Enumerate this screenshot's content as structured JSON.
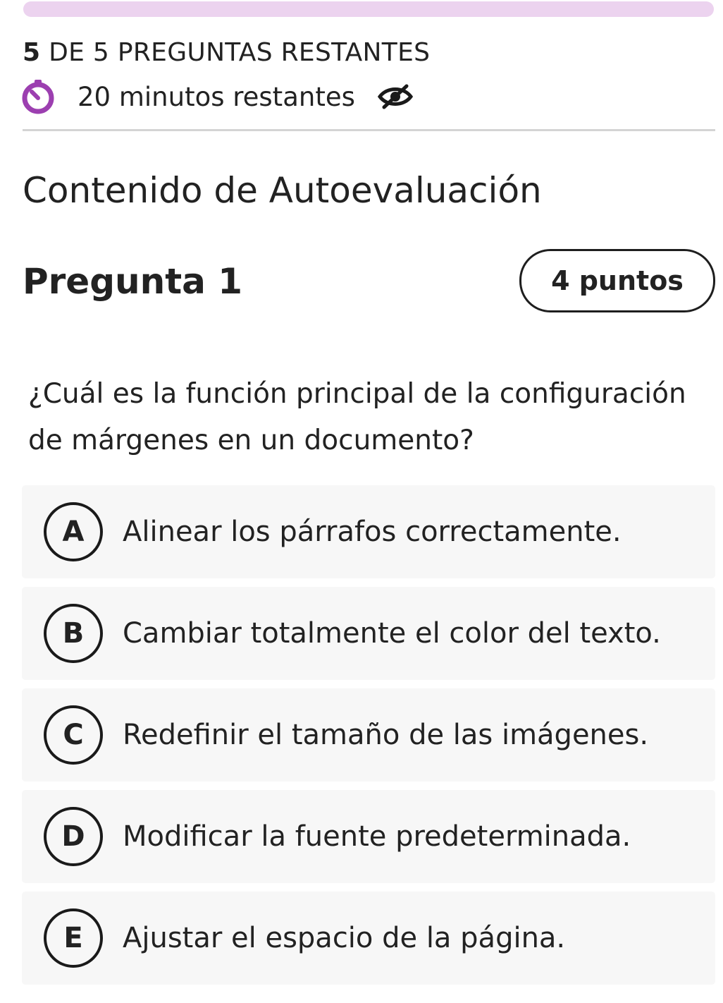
{
  "progress": {
    "current": "5",
    "text": " DE 5 PREGUNTAS RESTANTES",
    "color": "#ecd3ef"
  },
  "timer": {
    "icon": "timer-icon",
    "text": "20 minutos restantes",
    "toggle_icon": "eye-slash-icon",
    "accent": "#9c3fb0"
  },
  "section": {
    "title": "Contenido de Autoevaluación"
  },
  "question": {
    "title": "Pregunta 1",
    "points": "4 puntos",
    "text": "¿Cuál es la función principal de la configuración de márgenes en un documento?"
  },
  "options": [
    {
      "letter": "A",
      "text": "Alinear los párrafos correctamente."
    },
    {
      "letter": "B",
      "text": "Cambiar totalmente el color del texto."
    },
    {
      "letter": "C",
      "text": "Redefinir el tamaño de las imágenes."
    },
    {
      "letter": "D",
      "text": "Modificar la fuente predeterminada."
    },
    {
      "letter": "E",
      "text": "Ajustar el espacio de la página."
    }
  ]
}
